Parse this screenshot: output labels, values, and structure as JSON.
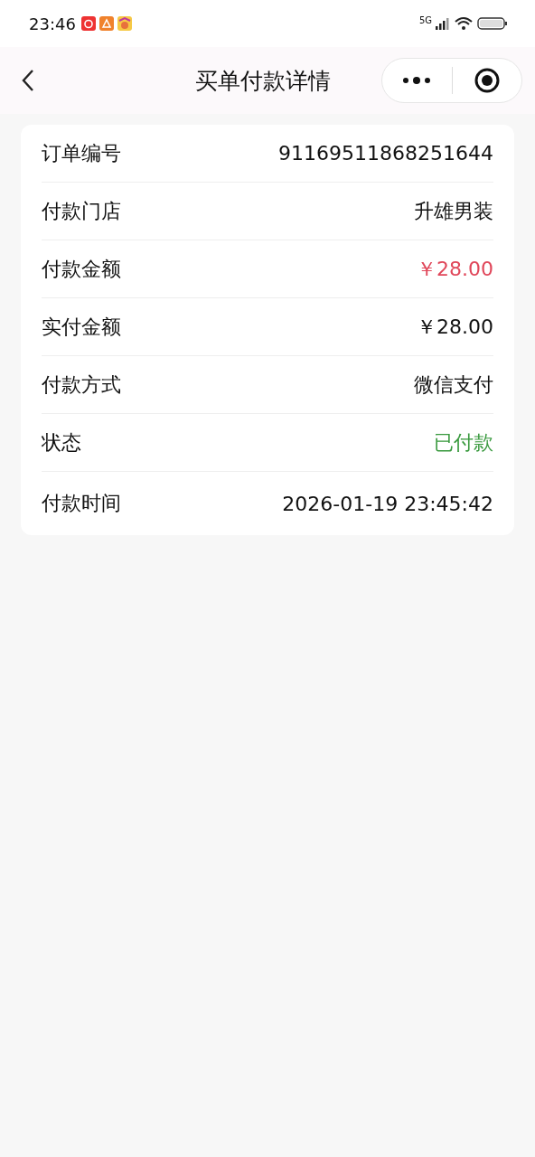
{
  "status_bar": {
    "time": "23:46",
    "network": "5G"
  },
  "header": {
    "title": "买单付款详情"
  },
  "details": [
    {
      "label": "订单编号",
      "value": "91169511868251644",
      "kind": "plain"
    },
    {
      "label": "付款门店",
      "value": "升雄男装",
      "kind": "plain"
    },
    {
      "label": "付款金额",
      "value": "￥28.00",
      "kind": "amount"
    },
    {
      "label": "实付金额",
      "value": "￥28.00",
      "kind": "plain"
    },
    {
      "label": "付款方式",
      "value": "微信支付",
      "kind": "plain"
    },
    {
      "label": "状态",
      "value": "已付款",
      "kind": "success"
    },
    {
      "label": "付款时间",
      "value": "2026-01-19 23:45:42",
      "kind": "plain"
    }
  ]
}
